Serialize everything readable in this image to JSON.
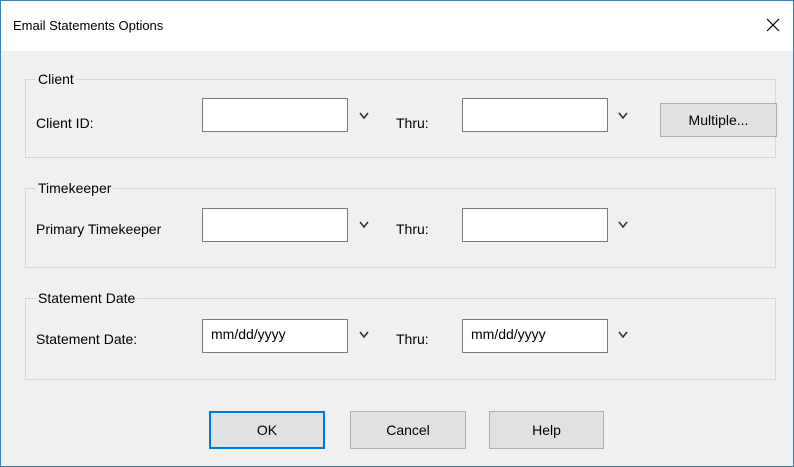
{
  "window": {
    "title": "Email Statements Options"
  },
  "client": {
    "group_label": "Client",
    "id_label": "Client ID:",
    "from_value": "",
    "thru_label": "Thru:",
    "thru_value": "",
    "multiple_label": "Multiple..."
  },
  "timekeeper": {
    "group_label": "Timekeeper",
    "primary_label": "Primary Timekeeper",
    "from_value": "",
    "thru_label": "Thru:",
    "thru_value": ""
  },
  "statement_date": {
    "group_label": "Statement Date",
    "date_label": "Statement Date:",
    "from_value": "mm/dd/yyyy",
    "thru_label": "Thru:",
    "thru_value": "mm/dd/yyyy"
  },
  "buttons": {
    "ok": "OK",
    "cancel": "Cancel",
    "help": "Help"
  },
  "icons": {
    "close": "close-icon",
    "dropdown": "chevron-down-icon"
  },
  "colors": {
    "accent": "#0078d7",
    "window_border": "#3c7fb1",
    "dialog_bg": "#f0f0f0"
  }
}
